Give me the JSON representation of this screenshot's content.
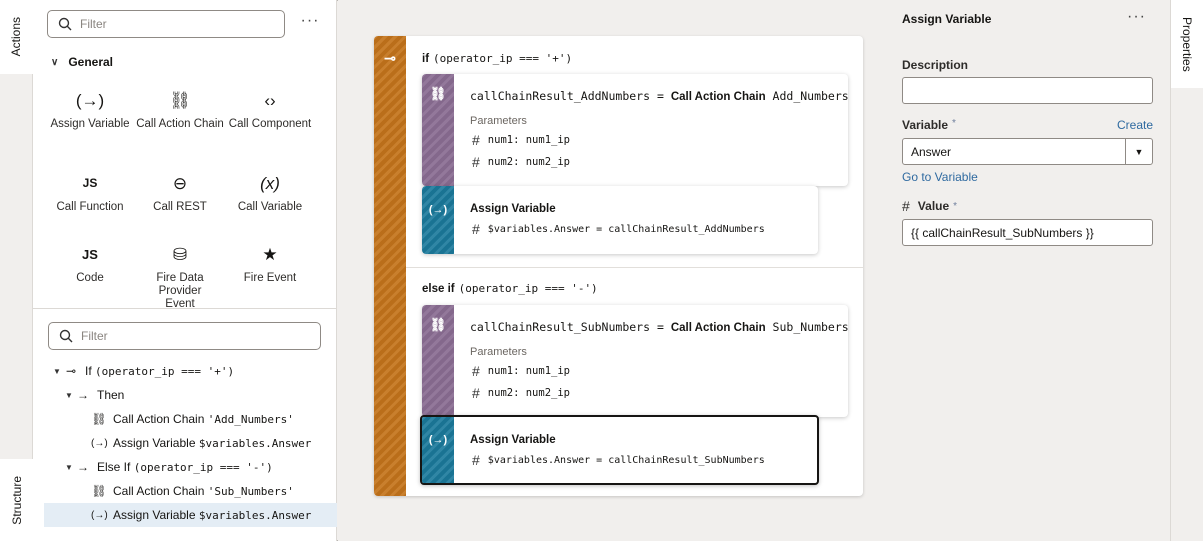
{
  "tabs": {
    "actions": "Actions",
    "structure": "Structure",
    "properties": "Properties"
  },
  "actions_panel": {
    "filter_placeholder": "Filter",
    "more": "···",
    "group": "General",
    "items": [
      {
        "icon": "(→)",
        "label": "Assign Variable"
      },
      {
        "icon": "⛓",
        "label": "Call Action Chain"
      },
      {
        "icon": "‹›",
        "label": "Call Component"
      },
      {
        "icon": "JS",
        "label": "Call Function"
      },
      {
        "icon": "⊖",
        "label": "Call REST"
      },
      {
        "icon": "(x)",
        "label": "Call Variable"
      },
      {
        "icon": "JS",
        "label": "Code"
      },
      {
        "icon": "⛁",
        "label": "Fire Data Provider Event"
      },
      {
        "icon": "★",
        "label": "Fire Event"
      }
    ]
  },
  "structure_panel": {
    "filter_placeholder": "Filter",
    "tree": [
      {
        "label": "If",
        "code": "(operator_ip === '+')"
      },
      {
        "label": "Then",
        "code": ""
      },
      {
        "label": "Call Action Chain",
        "code": "'Add_Numbers'"
      },
      {
        "label": "Assign Variable",
        "code": "$variables.Answer"
      },
      {
        "label": "Else If",
        "code": "(operator_ip === '-')"
      },
      {
        "label": "Call Action Chain",
        "code": "'Sub_Numbers'"
      },
      {
        "label": "Assign Variable",
        "code": "$variables.Answer"
      }
    ]
  },
  "canvas": {
    "if_keyword": "if",
    "if_condition": "(operator_ip === '+')",
    "elseif_keyword": "else if",
    "elseif_condition": "(operator_ip === '-')",
    "branch1": {
      "call_result": "callChainResult_AddNumbers",
      "call_eq": "=",
      "call_action": "Call Action Chain",
      "call_target": "Add_Numbers",
      "params_label": "Parameters",
      "param1": "num1: num1_ip",
      "param2": "num2: num2_ip",
      "assign_title": "Assign Variable",
      "assign_expr": "$variables.Answer = callChainResult_AddNumbers"
    },
    "branch2": {
      "call_result": "callChainResult_SubNumbers",
      "call_eq": "=",
      "call_action": "Call Action Chain",
      "call_target": "Sub_Numbers",
      "params_label": "Parameters",
      "param1": "num1: num1_ip",
      "param2": "num2: num2_ip",
      "assign_title": "Assign Variable",
      "assign_expr": "$variables.Answer = callChainResult_SubNumbers"
    }
  },
  "properties": {
    "title": "Assign Variable",
    "more": "···",
    "description_label": "Description",
    "description_value": "",
    "variable_label": "Variable",
    "required_mark": "*",
    "create_link": "Create",
    "variable_value": "Answer",
    "goto_link": "Go to Variable",
    "value_label": "Value",
    "value_value": "{{ callChainResult_SubNumbers }}"
  },
  "colors": {
    "if_bar": "#c4741b",
    "call_chain": "#8b6e93",
    "assign": "#1b7a9c",
    "link": "#2f6aa0",
    "selected_row": "#e4edf5"
  }
}
